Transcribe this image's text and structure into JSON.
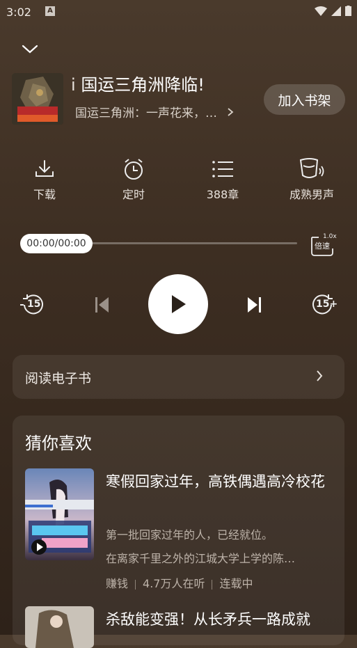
{
  "status": {
    "time": "3:02",
    "app_icon": "A"
  },
  "header": {
    "title": "国运三角洲降临!",
    "title_prefix_fragment": "i",
    "subtitle": "国运三角洲：一声花来，…",
    "add_shelf_label": "加入书架"
  },
  "actions": [
    {
      "icon": "download-icon",
      "label": "下载"
    },
    {
      "icon": "alarm-clock-icon",
      "label": "定时"
    },
    {
      "icon": "chapter-list-icon",
      "label": "388章"
    },
    {
      "icon": "voice-icon",
      "label": "成熟男声"
    }
  ],
  "player": {
    "time_display": "00:00/00:00",
    "progress": 0,
    "speed_value": "1.0x",
    "speed_label": "倍速",
    "rewind_label": "15",
    "forward_label": "15+"
  },
  "read_ebook": {
    "label": "阅读电子书"
  },
  "recommend": {
    "title": "猜你喜欢",
    "items": [
      {
        "name": "寒假回家过年，高铁偶遇高冷校花",
        "desc1": "第一批回家过年的人，已经就位。",
        "desc2": "在离家千里之外的江城大学上学的陈…",
        "tag": "赚钱",
        "listeners": "4.7万人在听",
        "status": "连载中"
      },
      {
        "name": "杀敌能变强！从长矛兵一路成就"
      }
    ]
  },
  "colors": {
    "background": "#3d2e22",
    "card": "rgba(255,255,255,0.07)",
    "accent": "#ffffff"
  }
}
